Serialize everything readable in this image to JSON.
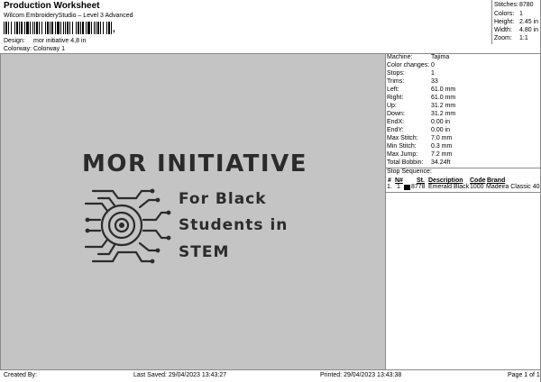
{
  "header": {
    "title": "Production Worksheet",
    "subtitle": "Wilcom EmbroideryStudio – Level 3 Advanced",
    "barcode_glyph": ","
  },
  "meta": {
    "design_label": "Design:",
    "design_value": "mor initiative 4,8 in",
    "colorway_label": "Colorway:",
    "colorway_value": "Colorway 1"
  },
  "summary": [
    {
      "label": "Stitches:",
      "value": "8780"
    },
    {
      "label": "Colors:",
      "value": "1"
    },
    {
      "label": "Height:",
      "value": "2.45 in"
    },
    {
      "label": "Width:",
      "value": "4.80 in"
    },
    {
      "label": "Zoom:",
      "value": "1:1"
    }
  ],
  "design_preview": {
    "title": "MOR INITIATIVE",
    "tagline": [
      "For Black",
      "Students in",
      "STEM"
    ],
    "background_color": "#c4c4c4",
    "thread_color": "#2b2b2b"
  },
  "info": [
    {
      "label": "Machine:",
      "value": "Tajima"
    },
    {
      "label": "Color changes:",
      "value": "0"
    },
    {
      "label": "Stops:",
      "value": "1"
    },
    {
      "label": "Trims:",
      "value": "33"
    },
    {
      "label": "Left:",
      "value": "61.0 mm"
    },
    {
      "label": "Right:",
      "value": "61.0 mm"
    },
    {
      "label": "Up:",
      "value": "31.2 mm"
    },
    {
      "label": "Down:",
      "value": "31.2 mm"
    },
    {
      "label": "EndX:",
      "value": "0.00 in"
    },
    {
      "label": "EndY:",
      "value": "0.00 in"
    },
    {
      "label": "Max Stitch:",
      "value": "7.0 mm"
    },
    {
      "label": "Min Stitch:",
      "value": "0.3 mm"
    },
    {
      "label": "Max Jump:",
      "value": "7.2 mm"
    },
    {
      "label": "Total Bobbin:",
      "value": "34.24ft"
    }
  ],
  "stop_sequence": {
    "title": "Stop Sequence:",
    "columns": [
      "#",
      "N#",
      "St.",
      "Description",
      "Code",
      "Brand"
    ],
    "rows": [
      {
        "num": "1.",
        "n": "1",
        "swatch_color": "#000000",
        "stitches": "8778",
        "description": "Emerald Black",
        "code": "1000",
        "brand": "Madeira Classic 40"
      }
    ]
  },
  "footer": {
    "created_by": "Created By:",
    "last_saved": "Last Saved: 29/04/2023 13:43:27",
    "printed": "Printed: 29/04/2023 13:43:38",
    "page": "Page 1 of 1"
  }
}
